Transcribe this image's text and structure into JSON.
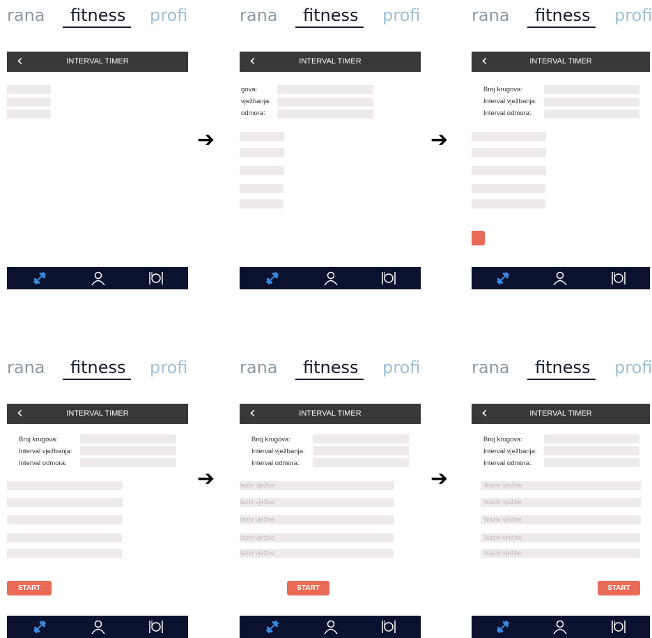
{
  "tabs": {
    "left": "rana",
    "active": "fitness",
    "right": "profi"
  },
  "header": {
    "back_icon": "‹",
    "title": "INTERVAL TIMER"
  },
  "labels": {
    "rounds": "Broj krugova:",
    "work": "Interval vježbanja:",
    "rest": "Interval odmora:"
  },
  "partial_labels": {
    "rounds": "gova:",
    "work": "vježbanja:",
    "rest": "odmora:"
  },
  "exercise_placeholder": "Naziv vježbe",
  "exercise_placeholder_cut": "laziv vježbe",
  "start_label": "START",
  "arrow": "➔",
  "nav": {
    "icons": [
      "dumbbell-icon",
      "user-icon",
      "meal-plate-icon"
    ],
    "active_color": "#3a8ee6",
    "inactive_color": "#ffffff",
    "bg": "#0b1230"
  },
  "colors": {
    "accent": "#e96a56",
    "header": "#383838",
    "field": "#efeaea"
  }
}
